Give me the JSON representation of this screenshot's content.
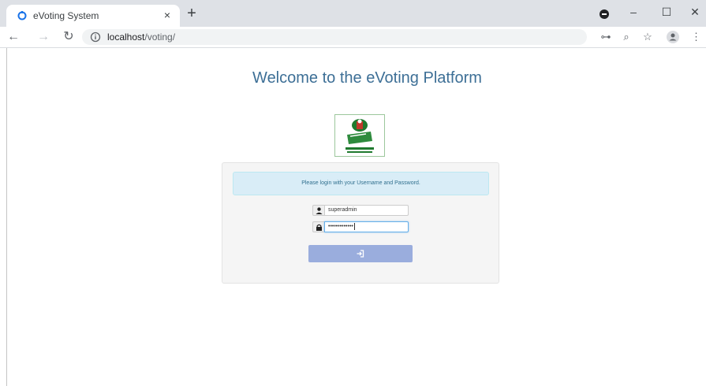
{
  "browser": {
    "tab_title": "eVoting System",
    "tab_close": "×",
    "new_tab": "+",
    "url_host": "localhost",
    "url_path": "/voting/",
    "window_controls": {
      "minimize": "–",
      "maximize": "☐",
      "close": "✕"
    },
    "toolbar_icons": [
      "back-icon",
      "forward-icon",
      "reload-icon",
      "info-icon",
      "key-icon",
      "zoom-icon",
      "star-icon",
      "account-icon",
      "menu-icon"
    ]
  },
  "page": {
    "welcome_title": "Welcome to the eVoting Platform",
    "logo_caption": "INDEPENDENT NATIONAL ELECTORAL COMMISSION",
    "login": {
      "message": "Please login with your Username and Password.",
      "username_value": "superadmin",
      "password_value": "•••••••••••••",
      "submit_icon": "sign-in-icon"
    }
  },
  "colors": {
    "title": "#3d6f96",
    "alert_bg": "#d9edf7",
    "alert_text": "#31708f",
    "button": "#9aaddd"
  }
}
